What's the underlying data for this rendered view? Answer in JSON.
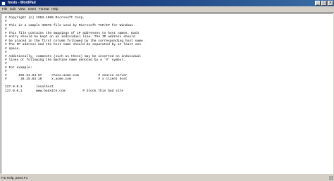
{
  "window": {
    "title": "hosts - WordPad",
    "controls": [
      "_",
      "□",
      "×"
    ]
  },
  "menu": [
    "File",
    "Edit",
    "View",
    "Insert",
    "Format",
    "Help"
  ],
  "document": {
    "content": "# Copyright (c) 1993-1999 Microsoft Corp.\n#\n# This is a sample HOSTS file used by Microsoft TCP/IP for Windows.\n#\n# This file contains the mappings of IP addresses to host names. Each\n# entry should be kept on an individual line. The IP address should\n# be placed in the first column followed by the corresponding host name.\n# The IP address and the host name should be separated by at least one\n# space.\n#\n# Additionally, comments (such as these) may be inserted on individual\n# lines or following the machine name denoted by a '#' symbol.\n#\n# For example:\n#\n#      102.54.94.97     rhino.acme.com          # source server\n#       38.25.63.10     x.acme.com              # x client host\n\n127.0.0.1       localhost\n127.0.0.1       www.badsite.com         # block this bad site"
  },
  "status": {
    "text": "For Help, press F1"
  }
}
